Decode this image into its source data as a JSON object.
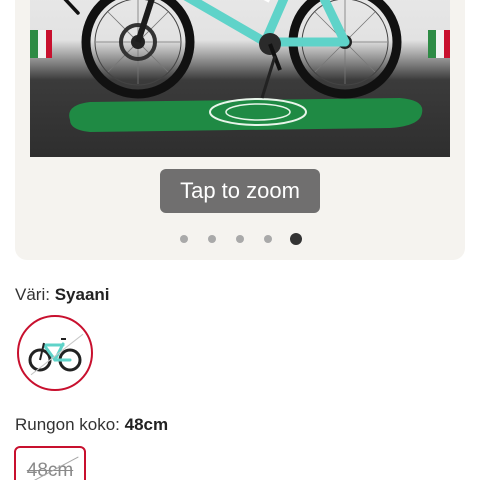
{
  "gallery": {
    "tap_to_zoom": "Tap to zoom",
    "prev_icon": "chevron-left-icon",
    "slide_count": 5,
    "active_slide": 5,
    "colors": {
      "accent": "#c8102e",
      "frame": "#5fd3c9",
      "mat": "#1f8a44"
    }
  },
  "color_option": {
    "label": "Väri:",
    "value": "Syaani"
  },
  "size_option": {
    "label": "Rungon koko:",
    "value": "48cm",
    "chips": [
      {
        "label": "48cm",
        "available": false
      }
    ]
  }
}
